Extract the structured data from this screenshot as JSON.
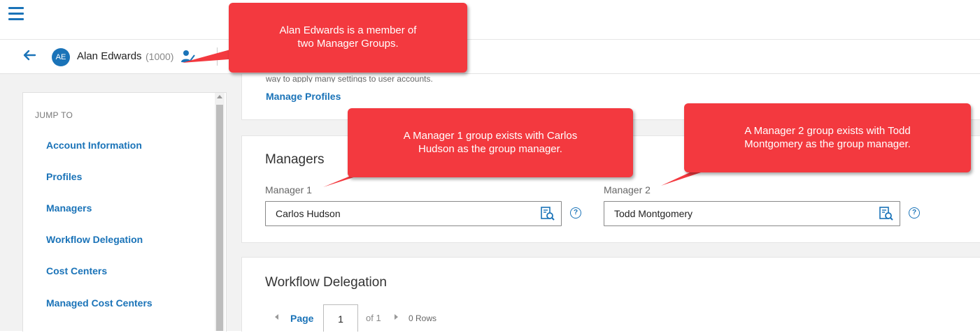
{
  "user": {
    "avatar_initials": "AE",
    "name": "Alan Edwards",
    "id": "(1000)"
  },
  "profiles_section": {
    "description": "way to apply many settings to user accounts.",
    "manage_link": "Manage Profiles"
  },
  "sidebar": {
    "heading": "JUMP TO",
    "items": [
      {
        "label": "Account Information"
      },
      {
        "label": "Profiles"
      },
      {
        "label": "Managers"
      },
      {
        "label": "Workflow Delegation"
      },
      {
        "label": "Cost Centers"
      },
      {
        "label": "Managed Cost Centers"
      }
    ]
  },
  "managers": {
    "title": "Managers",
    "manager1": {
      "label": "Manager 1",
      "value": "Carlos Hudson"
    },
    "manager2": {
      "label": "Manager 2",
      "value": "Todd Montgomery"
    }
  },
  "workflow": {
    "title": "Workflow Delegation",
    "pager": {
      "page_label": "Page",
      "page_value": "1",
      "of_text": "of 1",
      "rows_text": "0 Rows"
    }
  },
  "callouts": [
    {
      "line1": "Alan Edwards is a member of",
      "line2": "two Manager Groups."
    },
    {
      "line1": "A Manager 1 group exists with Carlos",
      "line2": "Hudson as the group manager."
    },
    {
      "line1": "A Manager 2 group exists with Todd",
      "line2": "Montgomery as the group manager."
    }
  ],
  "colors": {
    "accent": "#1a73b8",
    "callout": "#f3393f",
    "background": "#f2f2f2"
  },
  "icons": [
    "hamburger-menu-icon",
    "back-arrow-icon",
    "user-group-icon",
    "lookup-search-icon",
    "help-circle-icon"
  ]
}
